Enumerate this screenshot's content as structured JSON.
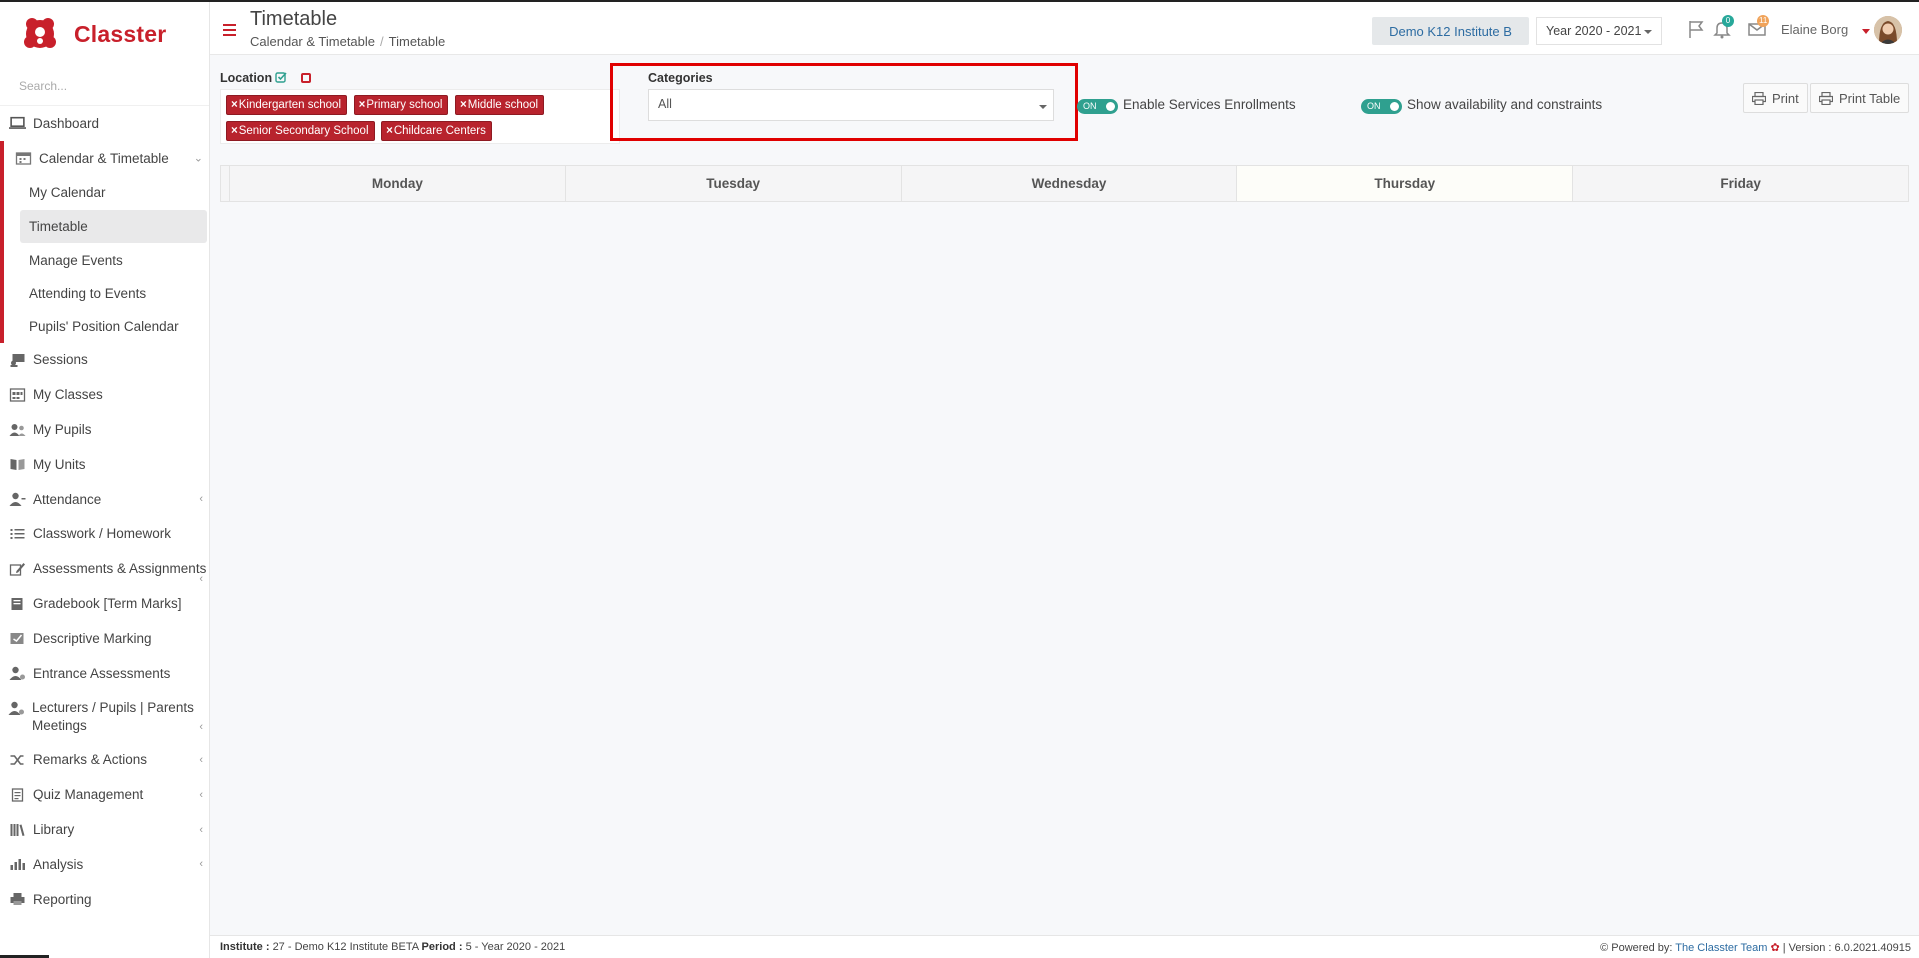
{
  "app": {
    "name": "Classter",
    "search_placeholder": "Search..."
  },
  "sidebar": {
    "items": [
      {
        "label": "Dashboard",
        "icon": "laptop-icon"
      },
      {
        "label": "Calendar & Timetable",
        "icon": "calendar-icon",
        "expanded": true,
        "children": [
          "My Calendar",
          "Timetable",
          "Manage Events",
          "Attending to Events",
          "Pupils' Position Calendar"
        ]
      },
      {
        "label": "Sessions",
        "icon": "sessions-icon"
      },
      {
        "label": "My Classes",
        "icon": "classes-icon"
      },
      {
        "label": "My Pupils",
        "icon": "pupils-icon"
      },
      {
        "label": "My Units",
        "icon": "book-icon"
      },
      {
        "label": "Attendance",
        "icon": "attendance-icon"
      },
      {
        "label": "Classwork / Homework",
        "icon": "list-icon"
      },
      {
        "label": "Assessments & Assignments",
        "icon": "edit-icon"
      },
      {
        "label": "Gradebook [Term Marks]",
        "icon": "gradebook-icon"
      },
      {
        "label": "Descriptive Marking",
        "icon": "marking-icon"
      },
      {
        "label": "Entrance Assessments",
        "icon": "user-icon"
      },
      {
        "label": "Lecturers / Pupils | Parents Meetings",
        "icon": "meetings-icon"
      },
      {
        "label": "Remarks & Actions",
        "icon": "shuffle-icon"
      },
      {
        "label": "Quiz Management",
        "icon": "quiz-icon"
      },
      {
        "label": "Library",
        "icon": "library-icon"
      },
      {
        "label": "Analysis",
        "icon": "chart-icon"
      },
      {
        "label": "Reporting",
        "icon": "printer-icon"
      }
    ],
    "active_child": "Timetable"
  },
  "header": {
    "title": "Timetable",
    "breadcrumb": [
      "Calendar & Timetable",
      "Timetable"
    ],
    "institute": "Demo K12 Institute B",
    "year": "Year 2020 - 2021",
    "notifications_count": "0",
    "messages_count": "11",
    "user_name": "Elaine Borg"
  },
  "filters": {
    "location_label": "Location",
    "locations": [
      "Kindergarten school",
      "Primary school",
      "Middle school",
      "Senior Secondary School",
      "Childcare Centers"
    ],
    "categories_label": "Categories",
    "categories_value": "All",
    "toggle_on_text": "ON",
    "enable_services_label": "Enable Services Enrollments",
    "show_availability_label": "Show availability and constraints",
    "print_label": "Print",
    "print_table_label": "Print Table"
  },
  "timetable": {
    "days": [
      "Monday",
      "Tuesday",
      "Wednesday",
      "Thursday",
      "Friday"
    ]
  },
  "footer": {
    "institute_label": "Institute :",
    "institute_value": "27 - Demo K12 Institute BETA",
    "period_label": "Period :",
    "period_value": "5 - Year 2020 - 2021",
    "powered_by": "Powered by:",
    "team": "The Classter Team",
    "version": "| Version : 6.0.2021.40915"
  },
  "colors": {
    "brand": "#c8202b",
    "toggle": "#2fa08f",
    "link": "#2d6ca2"
  }
}
